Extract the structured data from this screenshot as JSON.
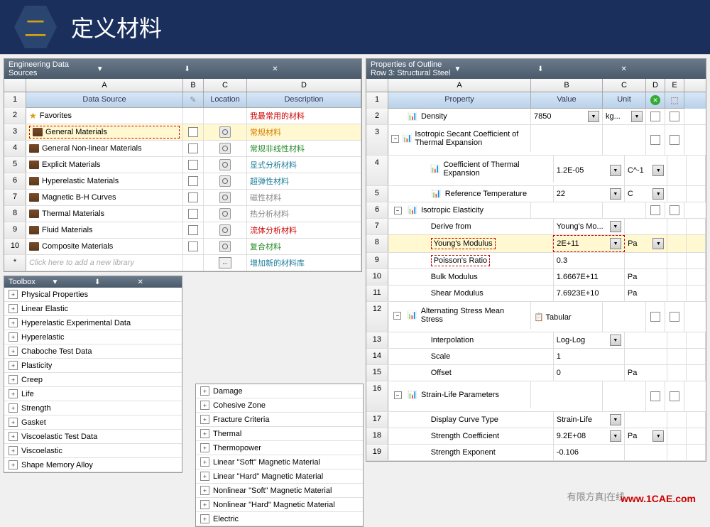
{
  "banner": {
    "hex_char": "二",
    "title": "定义材料"
  },
  "eds": {
    "title": "Engineering Data Sources",
    "col_letters": [
      "A",
      "B",
      "C",
      "D"
    ],
    "headers": [
      "Data Source",
      "",
      "Location",
      "Description"
    ],
    "rows": [
      {
        "n": "2",
        "type": "star",
        "name": "Favorites",
        "desc": "我最常用的材料",
        "cls": "desc-red"
      },
      {
        "n": "3",
        "type": "book",
        "name": "General Materials",
        "desc": "常规材料",
        "cls": "desc-orange",
        "hl": true,
        "dashed": true,
        "chk": true,
        "loc": true
      },
      {
        "n": "4",
        "type": "book",
        "name": "General Non-linear Materials",
        "desc": "常规非线性材料",
        "cls": "desc-green",
        "chk": true,
        "loc": true
      },
      {
        "n": "5",
        "type": "book",
        "name": "Explicit Materials",
        "desc": "显式分析材料",
        "cls": "desc-blue",
        "chk": true,
        "loc": true
      },
      {
        "n": "6",
        "type": "book",
        "name": "Hyperelastic Materials",
        "desc": "超弹性材料",
        "cls": "desc-blue",
        "chk": true,
        "loc": true
      },
      {
        "n": "7",
        "type": "book",
        "name": "Magnetic B-H Curves",
        "desc": "磁性材料",
        "cls": "desc-gray",
        "chk": true,
        "loc": true
      },
      {
        "n": "8",
        "type": "book",
        "name": "Thermal Materials",
        "desc": "热分析材料",
        "cls": "desc-gray",
        "chk": true,
        "loc": true
      },
      {
        "n": "9",
        "type": "book",
        "name": "Fluid Materials",
        "desc": "流体分析材料",
        "cls": "desc-red",
        "chk": true,
        "loc": true
      },
      {
        "n": "10",
        "type": "book",
        "name": "Composite Materials",
        "desc": "复合材料",
        "cls": "desc-green",
        "chk": true,
        "loc": true
      },
      {
        "n": "*",
        "type": "new",
        "name": "Click here to add a new library",
        "desc": "增加新的材料库",
        "cls": "desc-blue",
        "dots": true
      }
    ]
  },
  "toolbox": {
    "title": "Toolbox",
    "left": [
      "Physical Properties",
      "Linear Elastic",
      "Hyperelastic Experimental Data",
      "Hyperelastic",
      "Chaboche Test Data",
      "Plasticity",
      "Creep",
      "Life",
      "Strength",
      "Gasket",
      "Viscoelastic Test Data",
      "Viscoelastic",
      "Shape Memory Alloy"
    ],
    "right": [
      "Damage",
      "Cohesive Zone",
      "Fracture Criteria",
      "Thermal",
      "Thermopower",
      "Linear \"Soft\" Magnetic Material",
      "Linear \"Hard\" Magnetic Material",
      "Nonlinear \"Soft\" Magnetic Material",
      "Nonlinear \"Hard\" Magnetic Material",
      "Electric"
    ]
  },
  "props": {
    "title": "Properties of Outline Row 3: Structural Steel",
    "col_letters": [
      "A",
      "B",
      "C",
      "D",
      "E"
    ],
    "headers": [
      "Property",
      "Value",
      "Unit"
    ],
    "rows": [
      {
        "n": "2",
        "icon": "📊",
        "name": "Density",
        "val": "7850",
        "unit": "kg...",
        "dd": true,
        "chk": true
      },
      {
        "n": "3",
        "exp": true,
        "icon": "📊",
        "name": "Isotropic Secant Coefficient of Thermal Expansion",
        "chk": true,
        "tall": true
      },
      {
        "n": "4",
        "indent": true,
        "icon": "📊",
        "name": "Coefficient of Thermal Expansion",
        "val": "1.2E-05",
        "unit": "C^-1",
        "dd": true,
        "tall": true
      },
      {
        "n": "5",
        "indent": true,
        "icon": "📊",
        "name": "Reference Temperature",
        "val": "22",
        "unit": "C",
        "dd": true
      },
      {
        "n": "6",
        "exp": true,
        "icon": "📊",
        "name": "Isotropic Elasticity",
        "chk": true
      },
      {
        "n": "7",
        "indent": true,
        "name": "Derive from",
        "val": "Young's Mo...",
        "dd": true
      },
      {
        "n": "8",
        "indent": true,
        "name": "Young's Modulus",
        "val": "2E+11",
        "unit": "Pa",
        "dd": true,
        "hl": true,
        "dashed": true
      },
      {
        "n": "9",
        "indent": true,
        "name": "Poisson's Ratio",
        "val": "0.3",
        "dashed_name": true
      },
      {
        "n": "10",
        "indent": true,
        "name": "Bulk Modulus",
        "val": "1.6667E+11",
        "unit": "Pa"
      },
      {
        "n": "11",
        "indent": true,
        "name": "Shear Modulus",
        "val": "7.6923E+10",
        "unit": "Pa"
      },
      {
        "n": "12",
        "exp": true,
        "icon": "📊",
        "name": "Alternating Stress Mean Stress",
        "val": "📋 Tabular",
        "chk": true,
        "tall": true
      },
      {
        "n": "13",
        "indent": true,
        "name": "Interpolation",
        "val": "Log-Log",
        "dd": true
      },
      {
        "n": "14",
        "indent": true,
        "name": "Scale",
        "val": "1"
      },
      {
        "n": "15",
        "indent": true,
        "name": "Offset",
        "val": "0",
        "unit": "Pa"
      },
      {
        "n": "16",
        "exp": true,
        "icon": "📊",
        "name": "Strain-Life Parameters",
        "chk": true,
        "tall": true
      },
      {
        "n": "17",
        "indent": true,
        "name": "Display Curve Type",
        "val": "Strain-Life",
        "dd": true
      },
      {
        "n": "18",
        "indent": true,
        "name": "Strength Coefficient",
        "val": "9.2E+08",
        "unit": "Pa",
        "dd": true
      },
      {
        "n": "19",
        "indent": true,
        "name": "Strength Exponent",
        "val": "-0.106"
      }
    ]
  },
  "watermark": {
    "text": "www.1CAE.com",
    "gray": "有限方真|在线"
  }
}
